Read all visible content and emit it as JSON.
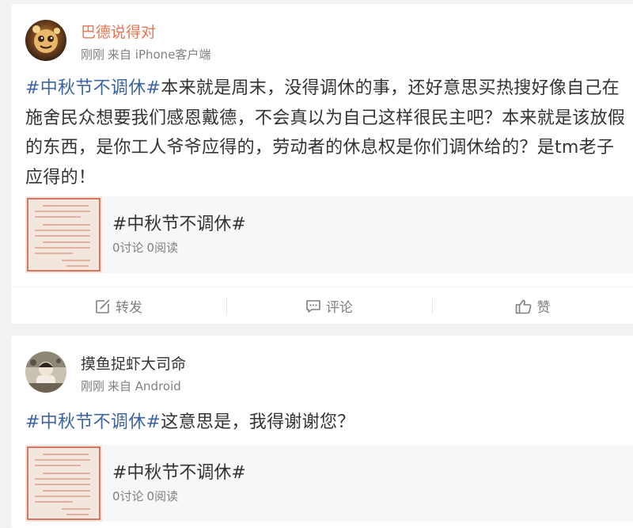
{
  "posts": [
    {
      "author": "巴德说得对",
      "time": "刚刚",
      "source": "来自 iPhone客户端",
      "hashtag": "#中秋节不调休#",
      "body": "本来就是周末，没得调休的事，还好意思买热搜好像自己在施舍民众想要我们感恩戴德，不会真以为自己这样很民主吧？本来就是该放假的东西，是你工人爷爷应得的，劳动者的休息权是你们调休给的？是tm老子应得的！",
      "topic": {
        "title": "#中秋节不调休#",
        "discussions": "0讨论",
        "reads": "0阅读"
      },
      "actions": {
        "forward": "转发",
        "comment": "评论",
        "like": "赞"
      }
    },
    {
      "author": "摸鱼捉虾大司命",
      "time": "刚刚",
      "source": "来自 Android",
      "hashtag": "#中秋节不调休#",
      "body": "这意思是，我得谢谢您？",
      "topic": {
        "title": "#中秋节不调休#",
        "discussions": "0讨论",
        "reads": "0阅读"
      }
    }
  ],
  "icons": {
    "forward": "forward-icon",
    "comment": "comment-icon",
    "like": "thumbs-up-icon"
  },
  "colors": {
    "hashtag": "#3c64a0",
    "author_highlight": "#eb7350",
    "muted_text": "#808080",
    "background": "#f2f2f5"
  }
}
